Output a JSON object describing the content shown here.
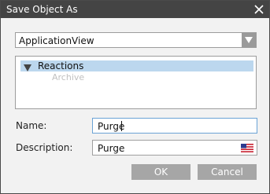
{
  "window": {
    "title": "Save Object As",
    "close_icon": "close-icon"
  },
  "combo": {
    "value": "ApplicationView",
    "dropdown_icon": "chevron-down-icon"
  },
  "tree": {
    "items": [
      {
        "label": "Reactions",
        "expanded": true,
        "selected": true
      },
      {
        "label": "Archive",
        "selected": false
      }
    ]
  },
  "form": {
    "name_label": "Name:",
    "name_value": "Purge",
    "description_label": "Description:",
    "description_value": "Purge",
    "language_icon": "us-flag-icon"
  },
  "buttons": {
    "ok": "OK",
    "cancel": "Cancel"
  },
  "colors": {
    "titlebar": "#444444",
    "selection": "#bcd7ee",
    "button": "#a6a6a6",
    "focus_border": "#6ba3d6"
  }
}
